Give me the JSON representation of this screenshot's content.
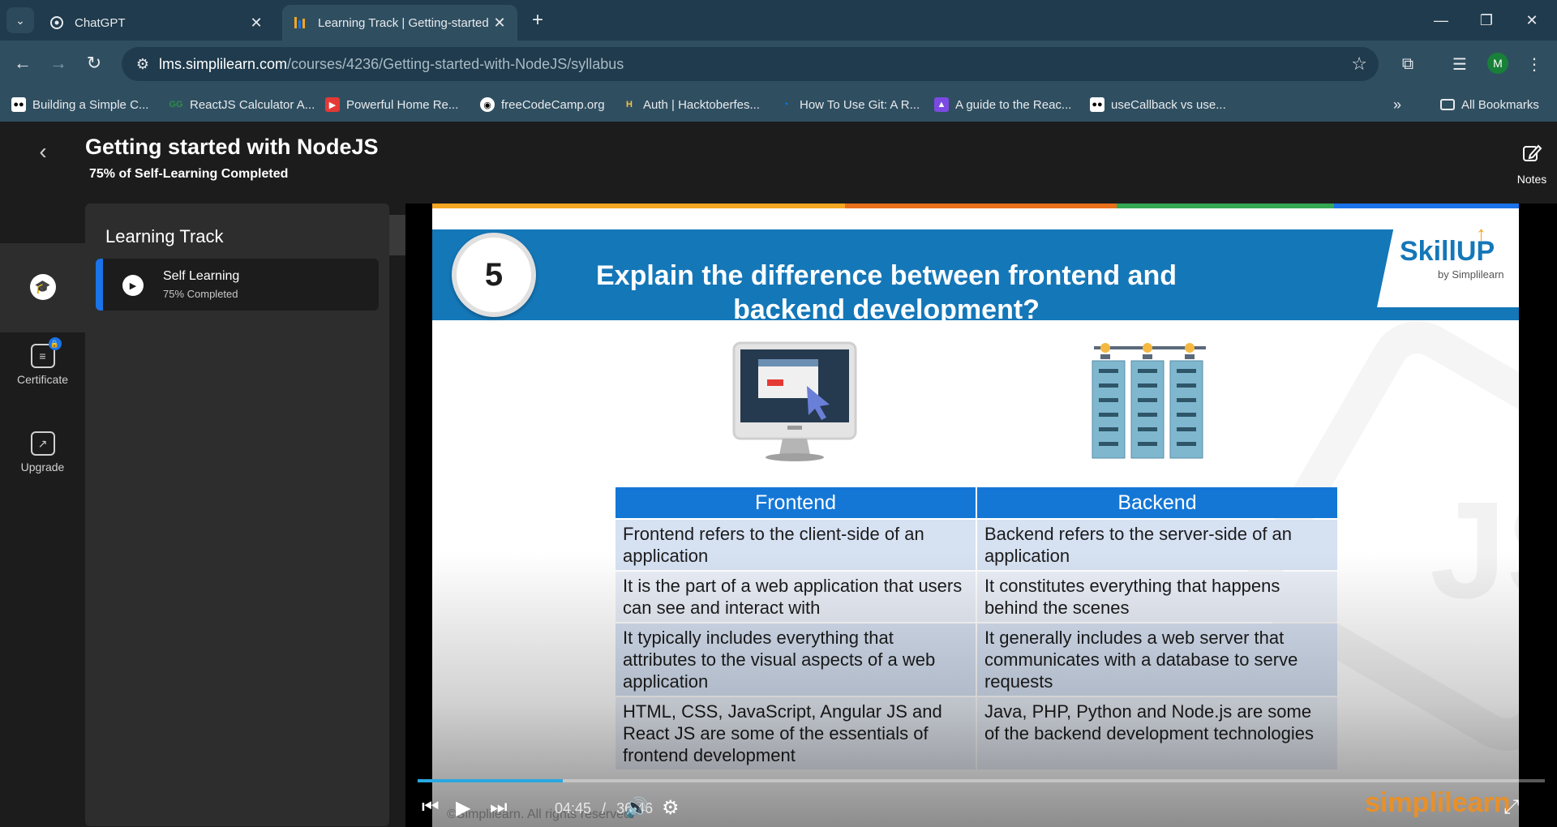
{
  "browser": {
    "tabs": [
      {
        "title": "ChatGPT",
        "favicon": "chatgpt-icon",
        "active": false
      },
      {
        "title": "Learning Track | Getting-started",
        "favicon": "simplilearn-icon",
        "active": true
      }
    ],
    "url_domain": "lms.simplilearn.com",
    "url_path": "/courses/4236/Getting-started-with-NodeJS/syllabus",
    "profile_initial": "M",
    "bookmarks": [
      {
        "label": "Building a Simple C...",
        "icon": "medium-icon"
      },
      {
        "label": "ReactJS Calculator A...",
        "icon": "geeks-icon"
      },
      {
        "label": "Powerful Home Re...",
        "icon": "youtube-icon"
      },
      {
        "label": "freeCodeCamp.org",
        "icon": "github-icon"
      },
      {
        "label": "Auth | Hacktoberfes...",
        "icon": "hacktoberfest-icon"
      },
      {
        "label": "How To Use Git: A R...",
        "icon": "digitalocean-icon"
      },
      {
        "label": "A guide to the Reac...",
        "icon": "rocket-icon"
      },
      {
        "label": "useCallback vs use...",
        "icon": "medium-icon"
      }
    ],
    "all_bookmarks": "All Bookmarks"
  },
  "course": {
    "title": "Getting started with NodeJS",
    "progress_text": "75% of Self-Learning Completed",
    "notes_label": "Notes"
  },
  "rail": {
    "certificate": "Certificate",
    "upgrade": "Upgrade"
  },
  "track": {
    "title": "Learning Track",
    "item_name": "Self Learning",
    "item_status": "75% Completed"
  },
  "slide": {
    "number": "5",
    "question_line1": "Explain the difference between frontend and",
    "question_line2": "backend development?",
    "brand": "SkillUP",
    "brand_sub": "by Simplilearn",
    "table_headers": [
      "Frontend",
      "Backend"
    ],
    "table_rows": [
      [
        "Frontend refers to the client-side of an application",
        "Backend refers to the server-side of an application"
      ],
      [
        "It is the part of a web application that users can see and interact with",
        "It constitutes everything that happens behind the scenes"
      ],
      [
        "It typically includes everything that attributes to the visual aspects of a web application",
        "It generally includes a web server that communicates with a database to serve requests"
      ],
      [
        "HTML, CSS, JavaScript, Angular JS and React JS are some of the essentials of frontend development",
        "Java, PHP, Python and Node.js are some of the backend development technologies"
      ]
    ],
    "footer_brand": "simplilearn",
    "copyright": "©Simplilearn. All rights reserved.",
    "watermark": "JS"
  },
  "player": {
    "current_time": "04:45",
    "separator": "/",
    "duration": "36:46",
    "played_fraction": 0.129,
    "buffered_fraction": 0.105
  },
  "colors": {
    "accent": "#1a73e8",
    "slide_banner": "#1477b8",
    "table_header": "#1477d6",
    "seek_fill": "#2aa8e0"
  }
}
